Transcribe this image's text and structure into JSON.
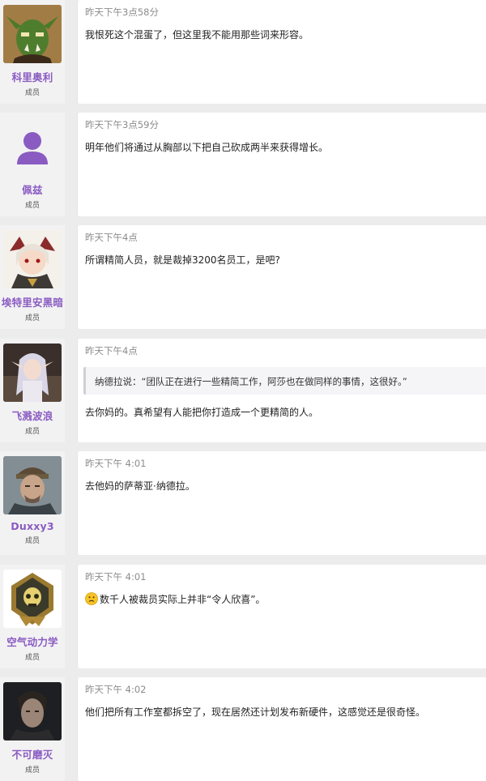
{
  "posts": [
    {
      "username": "科里奥利",
      "role": "成员",
      "time": "昨天下午3点58分",
      "message": "我恨死这个混蛋了，但这里我不能用那些词来形容。",
      "avatar": "orc-avatar"
    },
    {
      "username": "佩兹",
      "role": "成员",
      "time": "昨天下午3点59分",
      "message": "明年他们将通过从胸部以下把自己砍成两半来获得增长。",
      "avatar": "default-user-avatar"
    },
    {
      "username": "埃特里安黑暗",
      "role": "成员",
      "time": "昨天下午4点",
      "message": "所谓精简人员，就是裁掉3200名员工，是吧?",
      "avatar": "anime-girl-avatar"
    },
    {
      "username": "飞溅波浪",
      "role": "成员",
      "time": "昨天下午4点",
      "quote": "纳德拉说：“团队正在进行一些精简工作，阿莎也在做同样的事情，这很好。”",
      "message": "去你妈的。真希望有人能把你打造成一个更精简的人。",
      "avatar": "elf-avatar"
    },
    {
      "username": "Duxxy3",
      "role": "成员",
      "time": "昨天下午 4:01",
      "message": "去他妈的萨蒂亚·纳德拉。",
      "avatar": "soldier-avatar"
    },
    {
      "username": "空气动力学",
      "role": "成员",
      "time": "昨天下午 4:01",
      "message": "数千人被裁员实际上并非“令人欣喜”。",
      "emoji": "frowning-face-emoji",
      "avatar": "skull-emblem-avatar"
    },
    {
      "username": "不可磨灭",
      "role": "成员",
      "time": "昨天下午 4:02",
      "message": "他们把所有工作室都拆空了，现在居然还计划发布新硬件，这感觉还是很奇怪。",
      "avatar": "man-portrait-avatar"
    }
  ],
  "colors": {
    "username": "#8a5cc2",
    "timestamp": "#8c8c8c",
    "sidebar": "#f2f2f3",
    "page": "#ececec"
  }
}
